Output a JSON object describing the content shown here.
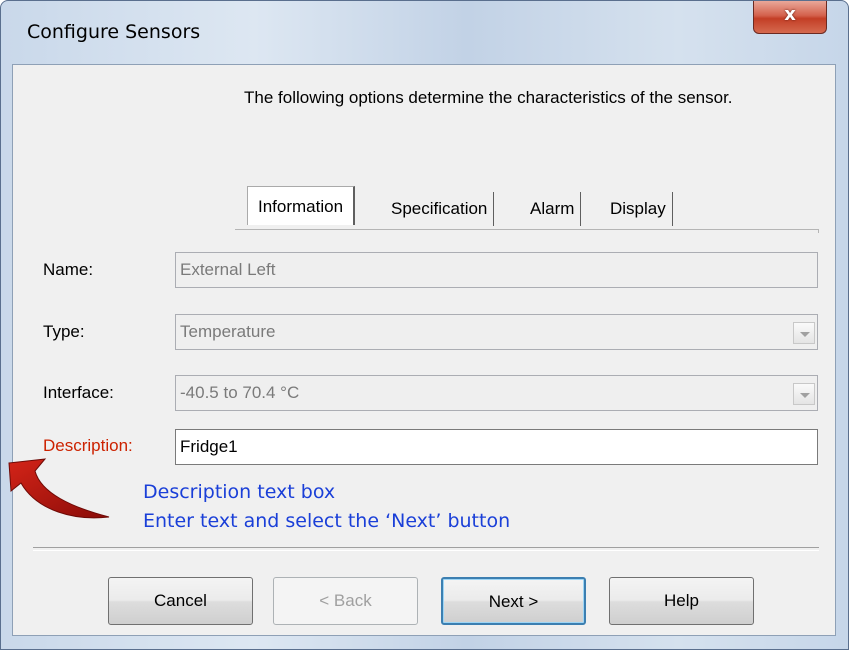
{
  "window": {
    "title": "Configure Sensors",
    "close_glyph": "x"
  },
  "intro_text": "The following options determine the characteristics of the sensor.",
  "tabs": [
    {
      "label": "Information",
      "active": true
    },
    {
      "label": "Specification",
      "active": false
    },
    {
      "label": "Alarm",
      "active": false
    },
    {
      "label": "Display",
      "active": false
    }
  ],
  "form": {
    "name": {
      "label": "Name:",
      "value": "External Left",
      "enabled": false
    },
    "type": {
      "label": "Type:",
      "value": "Temperature",
      "enabled": false
    },
    "interface": {
      "label": "Interface:",
      "value": "-40.5 to 70.4 °C",
      "enabled": false
    },
    "description": {
      "label": "Description:",
      "value": "Fridge1",
      "label_color": "#cc2200"
    }
  },
  "annotation": {
    "line1": "Description text box",
    "line2": "Enter text and select the ‘Next’ button",
    "color": "#1a3fd8",
    "arrow_icon": "curved-arrow-icon",
    "arrow_color": "#b2140e"
  },
  "buttons": {
    "cancel": "Cancel",
    "back": "< Back",
    "next": "Next >",
    "help": "Help"
  }
}
